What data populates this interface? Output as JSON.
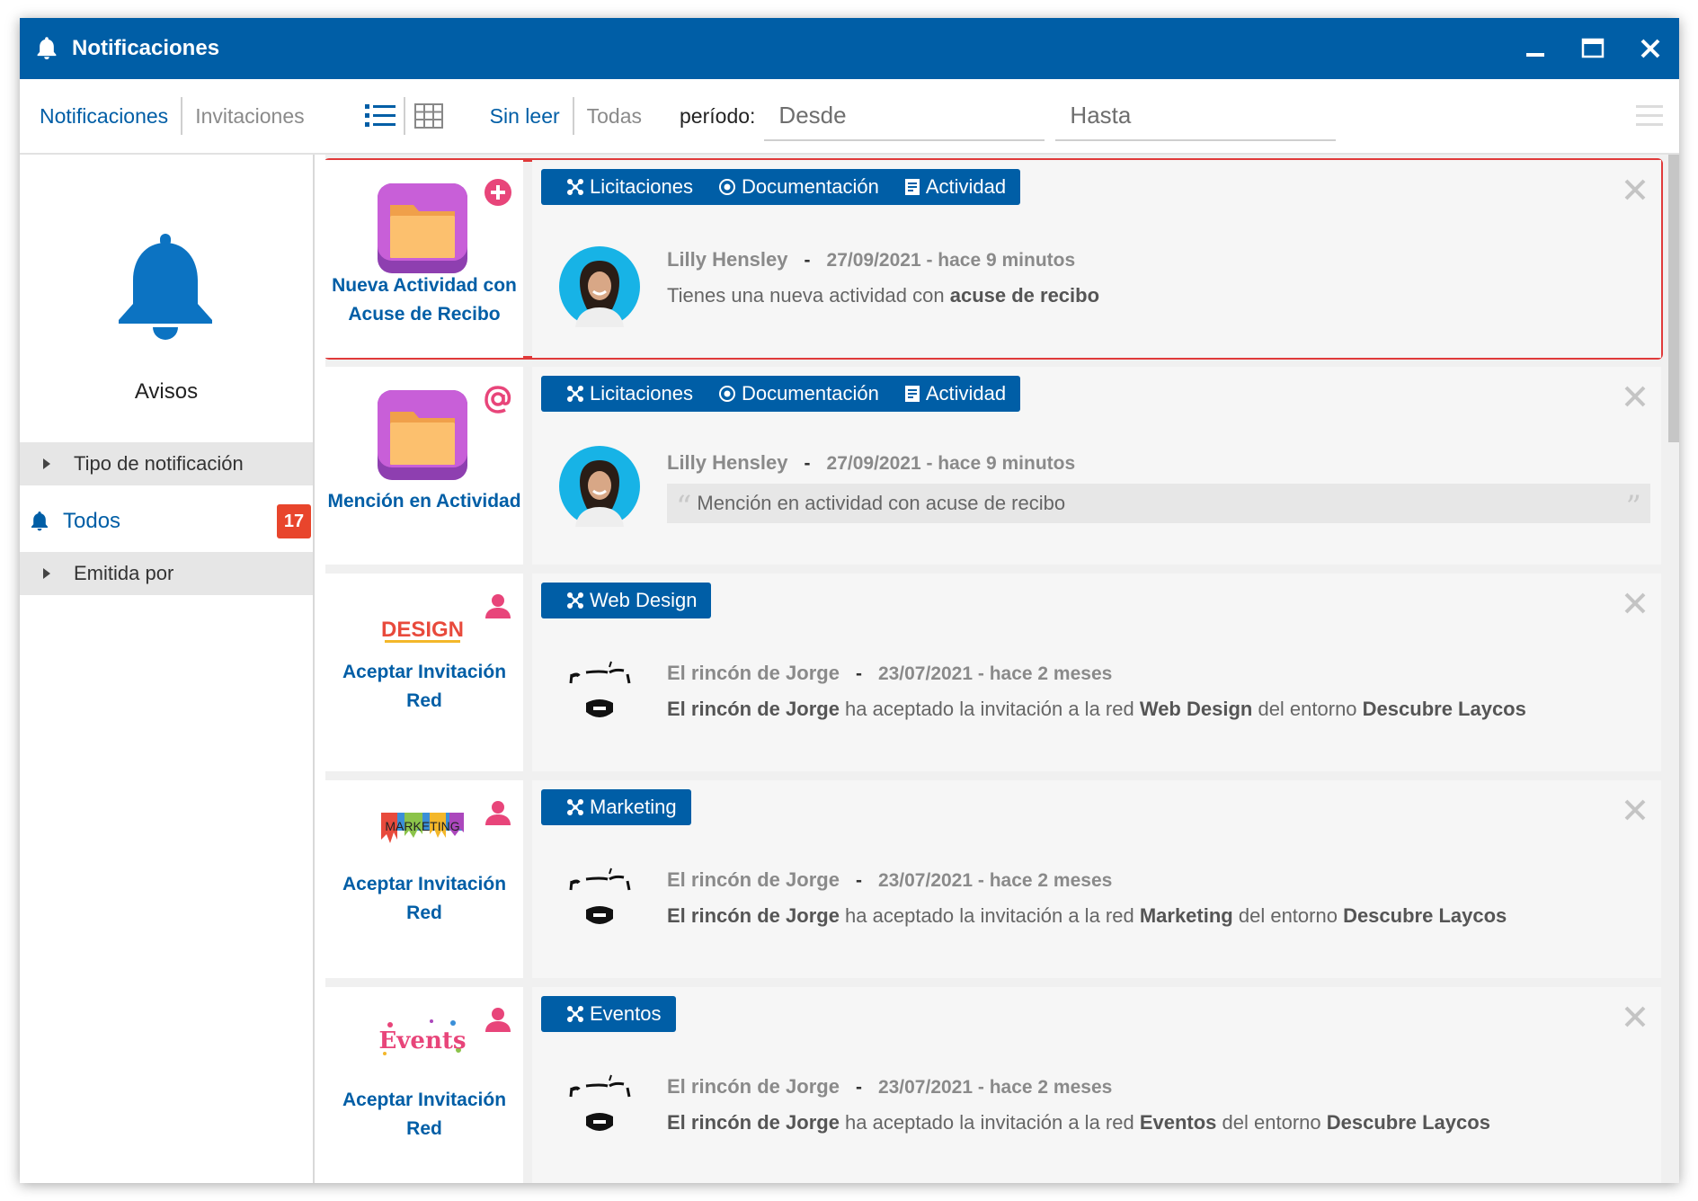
{
  "window": {
    "title": "Notificaciones",
    "accent": "#005ea6"
  },
  "toolbar": {
    "tab_notifications": "Notificaciones",
    "tab_invitations": "Invitaciones",
    "view_list_icon": "list-icon",
    "view_grid_icon": "grid-icon",
    "filter_unread": "Sin leer",
    "filter_all": "Todas",
    "period_label": "período:",
    "from_placeholder": "Desde",
    "to_placeholder": "Hasta"
  },
  "sidebar": {
    "title": "Avisos",
    "section_type": "Tipo de notificación",
    "item_all": "Todos",
    "item_all_count": "17",
    "section_sender": "Emitida por"
  },
  "notifications": [
    {
      "kind": "Nueva Actividad con Acuse de Recibo",
      "badge": "plus-circle-icon",
      "tags": [
        "Licitaciones",
        "Documentación",
        "Actividad"
      ],
      "author": "Lilly Hensley",
      "date": "27/09/2021 - hace 9 minutos",
      "message_pre": "Tienes una nueva actividad con ",
      "message_bold": "acuse de recibo",
      "selected": true
    },
    {
      "kind": "Mención en Actividad",
      "badge": "at-icon",
      "tags": [
        "Licitaciones",
        "Documentación",
        "Actividad"
      ],
      "author": "Lilly Hensley",
      "date": "27/09/2021 - hace 9 minutos",
      "quote": "Mención en actividad con acuse de recibo"
    },
    {
      "kind": "Aceptar Invitación Red",
      "badge": "person-icon",
      "logo_text": "DESIGN",
      "tags": [
        "Web Design"
      ],
      "author": "El rincón de Jorge",
      "date": "23/07/2021 - hace 2 meses",
      "msg_who": "El rincón de Jorge",
      "msg_mid": " ha aceptado la invitación a la red ",
      "msg_net": "Web Design",
      "msg_env_pre": " del entorno ",
      "msg_env": "Descubre Laycos"
    },
    {
      "kind": "Aceptar Invitación Red",
      "badge": "person-icon",
      "logo_text": "MARKETING",
      "tags": [
        "Marketing"
      ],
      "author": "El rincón de Jorge",
      "date": "23/07/2021 - hace 2 meses",
      "msg_who": "El rincón de Jorge",
      "msg_mid": " ha aceptado la invitación a la red ",
      "msg_net": "Marketing",
      "msg_env_pre": " del entorno ",
      "msg_env": "Descubre Laycos"
    },
    {
      "kind": "Aceptar Invitación Red",
      "badge": "person-icon",
      "logo_text": "Events",
      "tags": [
        "Eventos"
      ],
      "author": "El rincón de Jorge",
      "date": "23/07/2021 - hace 2 meses",
      "msg_who": "El rincón de Jorge",
      "msg_mid": " ha aceptado la invitación a la red ",
      "msg_net": "Eventos",
      "msg_env_pre": " del entorno ",
      "msg_env": "Descubre Laycos"
    }
  ]
}
